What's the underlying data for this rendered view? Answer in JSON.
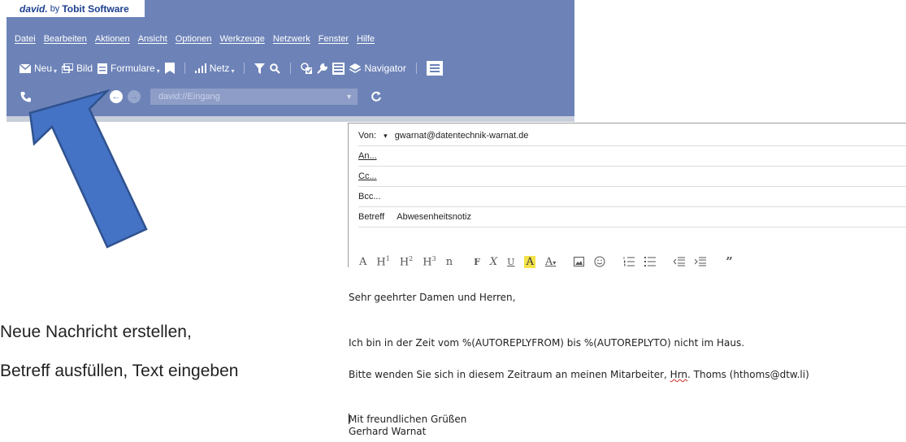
{
  "app": {
    "logo_brand": "david.",
    "logo_by": "by",
    "logo_company": "Tobit Software",
    "menu": [
      "Datei",
      "Bearbeiten",
      "Aktionen",
      "Ansicht",
      "Optionen",
      "Werkzeuge",
      "Netzwerk",
      "Fenster",
      "Hilfe"
    ],
    "toolbar": {
      "neu": "Neu",
      "bild": "Bild",
      "formulare": "Formulare",
      "netz": "Netz",
      "navigator": "Navigator"
    },
    "address_placeholder": "david://Eingang"
  },
  "mail": {
    "from_label": "Von:",
    "from_value": "gwarnat@datentechnik-warnat.de",
    "to_label": "An...",
    "cc_label": "Cc...",
    "bcc_label": "Bcc...",
    "subject_label": "Betreff",
    "subject_value": "Abwesenheitsnotiz",
    "format_tools": [
      "A",
      "H",
      "H",
      "H",
      "n",
      "F",
      "X",
      "U",
      "A",
      "A"
    ],
    "format_sup": [
      "1",
      "2",
      "3"
    ],
    "body": {
      "greeting": "Sehr geehrter Damen und Herren,",
      "line1": "Ich bin in der Zeit vom %(AUTOREPLYFROM) bis %(AUTOREPLYTO) nicht im Haus.",
      "line2_pre": "Bitte wenden Sie sich in diesem Zeitraum an meinen Mitarbeiter, ",
      "line2_hrn": "Hrn",
      "line2_post": ". Thoms (hthoms@dtw.li)",
      "closing": "Mit freundlichen Grüßen",
      "signature": "Gerhard Warnat"
    }
  },
  "instructions": {
    "line1": "Neue Nachricht erstellen,",
    "line2": "Betreff ausfüllen, Text eingeben"
  },
  "colors": {
    "app_bg": "#6d83b8",
    "arrow_fill": "#4472c4",
    "arrow_stroke": "#2f528f",
    "highlight": "#f3e24a"
  }
}
